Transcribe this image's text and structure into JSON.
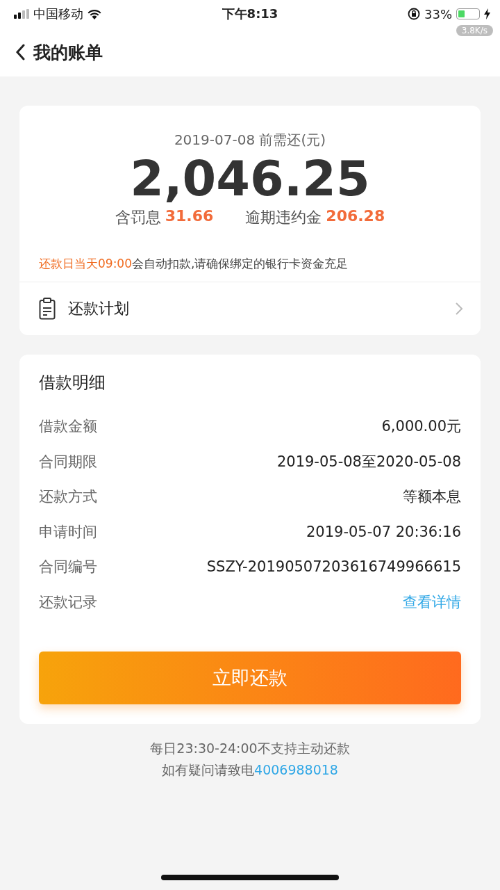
{
  "status_bar": {
    "carrier": "中国移动",
    "time": "下午8:13",
    "battery_percent": "33%",
    "battery": {
      "level": 0.33
    },
    "net_speed": "3.8K/s"
  },
  "nav": {
    "title": "我的账单"
  },
  "summary": {
    "due_label": "2019-07-08 前需还(元)",
    "amount": "2,046.25",
    "fees": [
      {
        "label": "含罚息",
        "value": "31.66"
      },
      {
        "label": "逾期违约金",
        "value": "206.28"
      }
    ],
    "notice": {
      "highlight": "还款日当天09:00",
      "text": "会自动扣款,请确保绑定的银行卡资金充足"
    },
    "plan": {
      "label": "还款计划"
    }
  },
  "details": {
    "title": "借款明细",
    "rows": [
      {
        "label": "借款金额",
        "value": "6,000.00元",
        "kind": "text"
      },
      {
        "label": "合同期限",
        "value": "2019-05-08至2020-05-08",
        "kind": "text"
      },
      {
        "label": "还款方式",
        "value": "等额本息",
        "kind": "text"
      },
      {
        "label": "申请时间",
        "value": "2019-05-07 20:36:16",
        "kind": "text"
      },
      {
        "label": "合同编号",
        "value": "SSZY-20190507203616749966615",
        "kind": "text"
      },
      {
        "label": "还款记录",
        "value": "查看详情",
        "kind": "link"
      }
    ],
    "button": "立即还款"
  },
  "footer": {
    "hours_note": "每日23:30-24:00不支持主动还款",
    "contact_text": "如有疑问请致电",
    "phone": "4006988018"
  }
}
